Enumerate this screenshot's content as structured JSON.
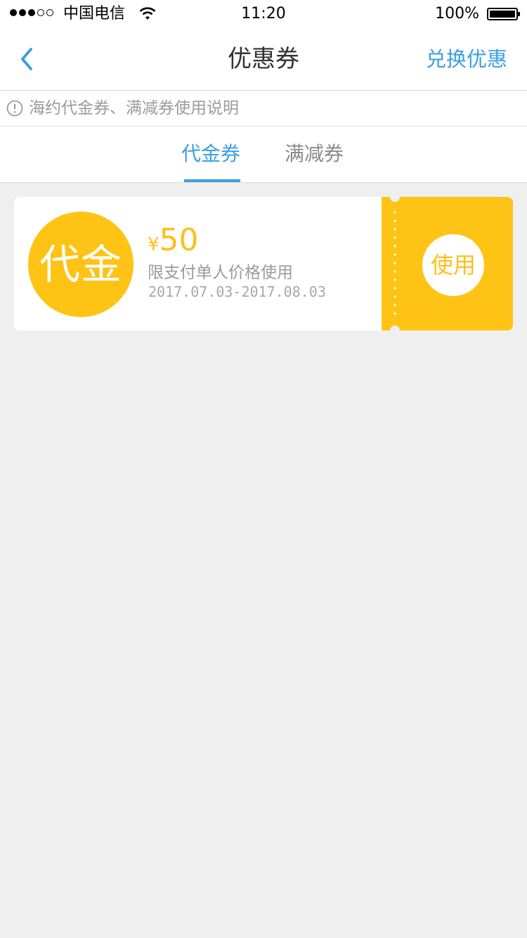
{
  "status_bar": {
    "signal_strength": "3/5",
    "carrier": "中国电信",
    "time": "11:20",
    "battery_percent": "100%"
  },
  "nav": {
    "title": "优惠券",
    "action_label": "兑换优惠"
  },
  "notice": {
    "text": "海约代金券、满减券使用说明"
  },
  "tabs": [
    {
      "label": "代金券",
      "active": true
    },
    {
      "label": "满减券",
      "active": false
    }
  ],
  "coupons": [
    {
      "badge": "代金",
      "currency": "¥",
      "amount": "50",
      "description": "限支付单人价格使用",
      "validity": "2017.07.03-2017.08.03",
      "action_label": "使用"
    }
  ],
  "colors": {
    "accent_blue": "#3aa0e0",
    "coupon_yellow": "#ffc316",
    "page_background": "#efefef"
  },
  "icons": {
    "back": "chevron-left-icon",
    "notice": "info-circle-icon",
    "wifi": "wifi-icon",
    "battery": "battery-icon"
  }
}
